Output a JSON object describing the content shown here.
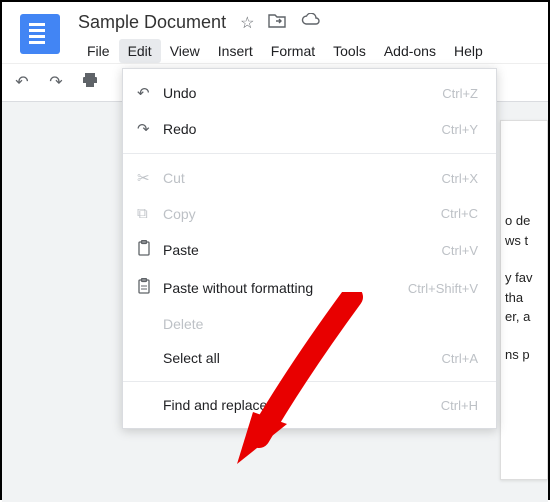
{
  "doc": {
    "title": "Sample Document"
  },
  "menubar": {
    "file": "File",
    "edit": "Edit",
    "view": "View",
    "insert": "Insert",
    "format": "Format",
    "tools": "Tools",
    "addons": "Add-ons",
    "help": "Help"
  },
  "edit_menu": {
    "undo": {
      "label": "Undo",
      "shortcut": "Ctrl+Z"
    },
    "redo": {
      "label": "Redo",
      "shortcut": "Ctrl+Y"
    },
    "cut": {
      "label": "Cut",
      "shortcut": "Ctrl+X"
    },
    "copy": {
      "label": "Copy",
      "shortcut": "Ctrl+C"
    },
    "paste": {
      "label": "Paste",
      "shortcut": "Ctrl+V"
    },
    "paste_plain": {
      "label": "Paste without formatting",
      "shortcut": "Ctrl+Shift+V"
    },
    "delete": {
      "label": "Delete",
      "shortcut": ""
    },
    "select_all": {
      "label": "Select all",
      "shortcut": "Ctrl+A"
    },
    "find_replace": {
      "label": "Find and replace",
      "shortcut": "Ctrl+H"
    }
  },
  "page_text": {
    "l1": "o de",
    "l2": "ws t",
    "l3": "y fav",
    "l4": " tha",
    "l5": "er, a",
    "l6": "ns p"
  }
}
